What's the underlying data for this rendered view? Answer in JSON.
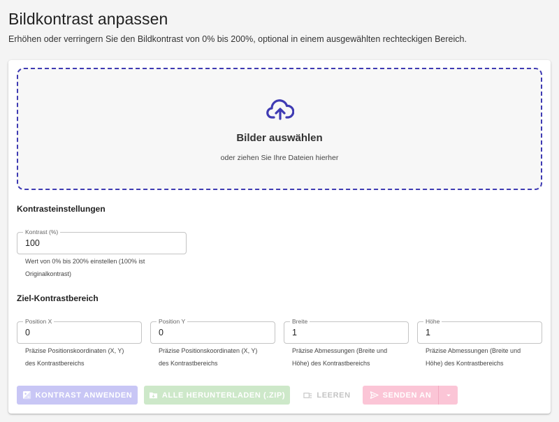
{
  "page": {
    "title": "Bildkontrast anpassen",
    "subtitle": "Erhöhen oder verringern Sie den Bildkontrast von 0% bis 200%, optional in einem ausgewählten rechteckigen Bereich."
  },
  "dropzone": {
    "icon": "cloud-upload-icon",
    "title": "Bilder auswählen",
    "subtitle": "oder ziehen Sie Ihre Dateien hierher"
  },
  "contrast_settings": {
    "heading": "Kontrasteinstellungen",
    "contrast_field": {
      "label": "Kontrast (%)",
      "value": "100",
      "helper_line1": "Wert von 0% bis 200% einstellen (100% ist",
      "helper_line2": "Originalkontrast)"
    }
  },
  "target_area": {
    "heading": "Ziel-Kontrastbereich",
    "fields": [
      {
        "label": "Position X",
        "value": "0",
        "helper_line1": "Präzise Positionskoordinaten (X, Y)",
        "helper_line2": "des Kontrastbereichs"
      },
      {
        "label": "Position Y",
        "value": "0",
        "helper_line1": "Präzise Positionskoordinaten (X, Y)",
        "helper_line2": "des Kontrastbereichs"
      },
      {
        "label": "Breite",
        "value": "1",
        "helper_line1": "Präzise Abmessungen (Breite und",
        "helper_line2": "Höhe) des Kontrastbereichs"
      },
      {
        "label": "Höhe",
        "value": "1",
        "helper_line1": "Präzise Abmessungen (Breite und",
        "helper_line2": "Höhe) des Kontrastbereichs"
      }
    ]
  },
  "actions": {
    "apply_contrast": "KONTRAST ANWENDEN",
    "download_all": "ALLE HERUNTERLADEN (.ZIP)",
    "clear": "LEEREN",
    "send_to": "SENDEN AN"
  },
  "colors": {
    "accent": "#3f3bb3",
    "apply_disabled": "#c8c6f5",
    "download_disabled": "#cde8c9",
    "send_disabled": "#fbc5d6"
  }
}
